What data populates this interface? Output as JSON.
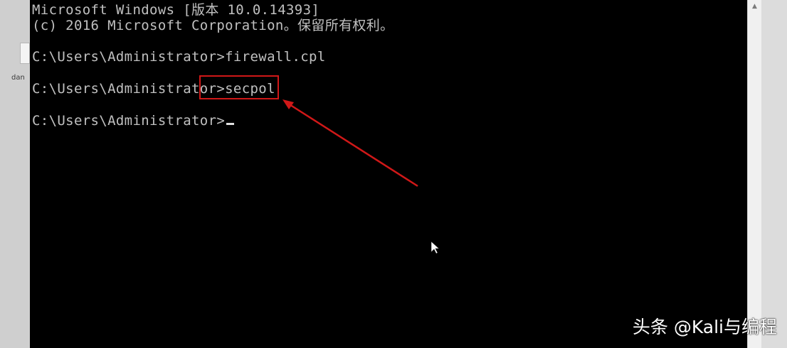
{
  "desktop": {
    "icon_label": "dan"
  },
  "console": {
    "lines": [
      "Microsoft Windows [版本 10.0.14393]",
      "(c) 2016 Microsoft Corporation。保留所有权利。",
      "C:\\Users\\Administrator>firewall.cpl",
      "C:\\Users\\Administrator>secpol",
      "C:\\Users\\Administrator>"
    ]
  },
  "annotation": {
    "color": "#d01818",
    "highlighted_text": "secpol"
  },
  "watermark": {
    "text": "头条 @Kali与编程"
  },
  "icons": {
    "cursor": "mouse-pointer-icon",
    "scroll_up": "scroll-up-arrow-icon"
  }
}
